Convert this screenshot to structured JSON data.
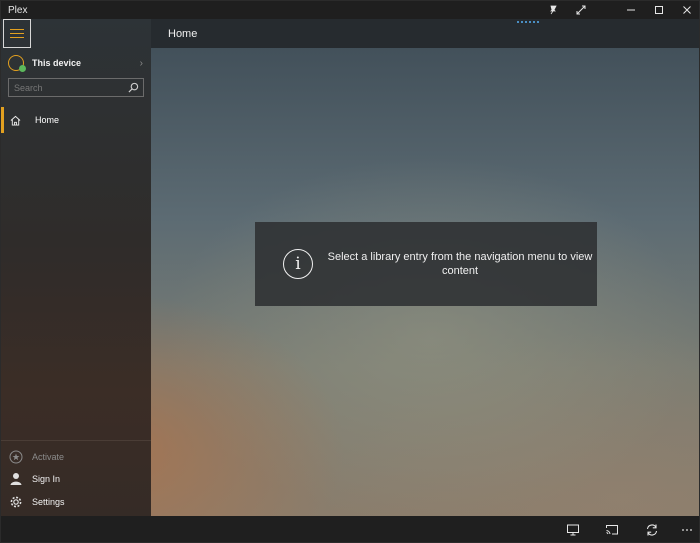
{
  "window": {
    "app_title": "Plex"
  },
  "header": {
    "title": "Home"
  },
  "sidebar": {
    "device_label": "This device",
    "search": {
      "placeholder": "Search",
      "value": ""
    },
    "nav_items": [
      {
        "label": "Home",
        "icon": "home-icon",
        "selected": true
      }
    ],
    "bottom_items": [
      {
        "label": "Activate",
        "icon": "star-icon",
        "enabled": false
      },
      {
        "label": "Sign In",
        "icon": "person-icon",
        "enabled": true
      },
      {
        "label": "Settings",
        "icon": "gear-icon",
        "enabled": true
      }
    ]
  },
  "main": {
    "info_message": "Select a library entry from the navigation menu to view content"
  },
  "colors": {
    "accent": "#e2a020",
    "device_status": "#5cb85c",
    "chrome": "#1f1f1f"
  },
  "bottom_bar": {
    "icons": [
      "screen-icon",
      "cast-icon",
      "sync-icon",
      "more-icon"
    ]
  }
}
